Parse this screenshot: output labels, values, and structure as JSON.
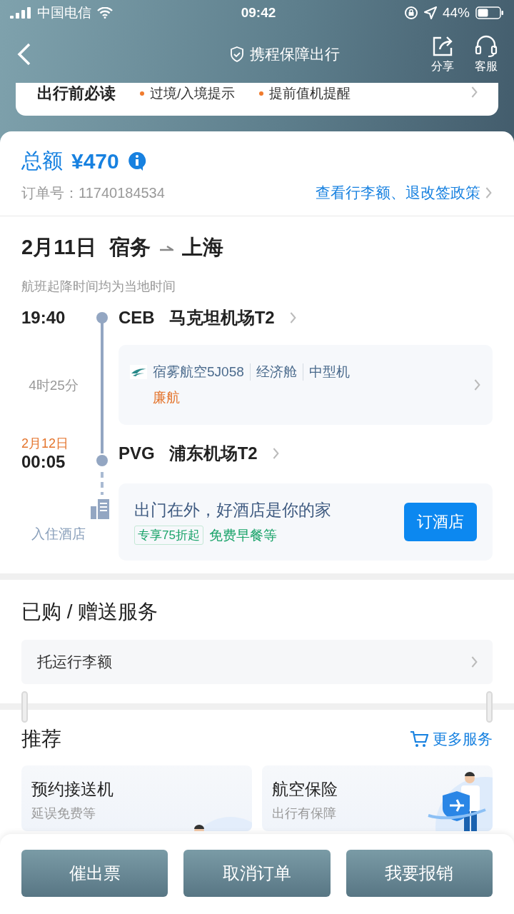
{
  "status_bar": {
    "carrier": "中国电信",
    "time": "09:42",
    "battery": "44%"
  },
  "nav": {
    "title": "携程保障出行",
    "actions": [
      {
        "kind": "share",
        "label": "分享"
      },
      {
        "kind": "service",
        "label": "客服"
      }
    ]
  },
  "notice": {
    "title": "出行前必读",
    "items": [
      "过境/入境提示",
      "提前值机提醒"
    ]
  },
  "order": {
    "total_label": "总额",
    "amount": "¥470",
    "order_no_label": "订单号：",
    "order_no": "11740184534",
    "policy_link": "查看行李额、退改签政策"
  },
  "flight": {
    "date": "2月11日",
    "from": "宿务",
    "to": "上海",
    "note": "航班起降时间均为当地时间",
    "departure": {
      "time": "19:40",
      "code": "CEB",
      "airport": "马克坦机场T2"
    },
    "duration": "4时25分",
    "segment": {
      "airline": "宿雾航空5J058",
      "cabin": "经济舱",
      "aircraft": "中型机",
      "tag": "廉航"
    },
    "arrival": {
      "date": "2月12日",
      "time": "00:05",
      "code": "PVG",
      "airport": "浦东机场T2"
    },
    "hotel": {
      "label": "入住酒店",
      "title": "出门在外，好酒店是你的家",
      "badge": "专享75折起",
      "perk": "免费早餐等",
      "button": "订酒店"
    }
  },
  "services": {
    "title": "已购 / 赠送服务",
    "items": [
      "托运行李额"
    ]
  },
  "recommend": {
    "title": "推荐",
    "more_link": "更多服务",
    "cards": [
      {
        "kind": "transfer",
        "title": "预约接送机",
        "subtitle": "延误免费等"
      },
      {
        "kind": "insurance",
        "title": "航空保险",
        "subtitle": "出行有保障"
      }
    ]
  },
  "actions": [
    "催出票",
    "取消订单",
    "我要报销"
  ]
}
